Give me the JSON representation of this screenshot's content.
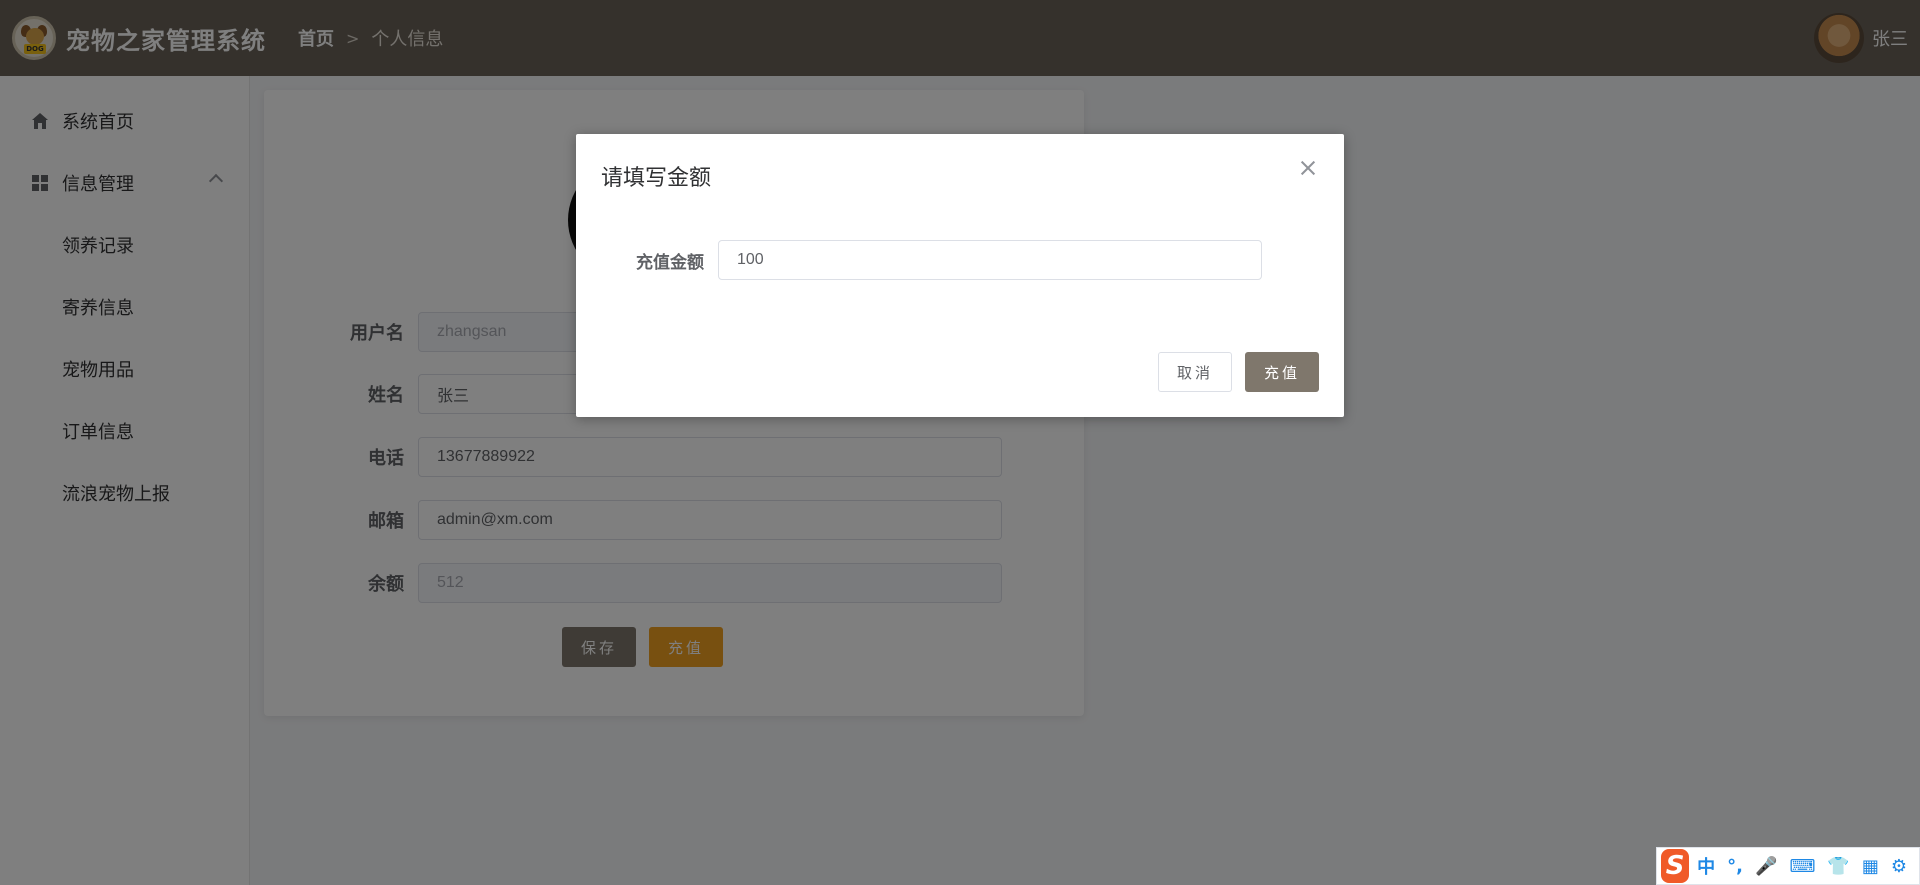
{
  "app": {
    "title": "宠物之家管理系统",
    "logo_tag": "DOG"
  },
  "header": {
    "breadcrumb_home": "首页",
    "breadcrumb_separator": ">",
    "breadcrumb_current": "个人信息",
    "user_name": "张三"
  },
  "sidebar": {
    "items": [
      {
        "label": "系统首页",
        "icon": "home-icon"
      },
      {
        "label": "信息管理",
        "icon": "grid-icon",
        "expanded": true
      }
    ],
    "sub_items": [
      {
        "label": "领养记录"
      },
      {
        "label": "寄养信息"
      },
      {
        "label": "宠物用品"
      },
      {
        "label": "订单信息"
      },
      {
        "label": "流浪宠物上报"
      }
    ]
  },
  "profile_form": {
    "username_label": "用户名",
    "username_value": "zhangsan",
    "name_label": "姓名",
    "name_value": "张三",
    "phone_label": "电话",
    "phone_value": "13677889922",
    "email_label": "邮箱",
    "email_value": "admin@xm.com",
    "balance_label": "余额",
    "balance_value": "512",
    "save_label": "保存",
    "recharge_label": "充值"
  },
  "dialog": {
    "title": "请填写金额",
    "amount_label": "充值金额",
    "amount_value": "100",
    "cancel_label": "取消",
    "confirm_label": "充值"
  },
  "ime": {
    "logo": "S",
    "items": [
      "中",
      "°,",
      "🎤",
      "⌨",
      "👕",
      "▦",
      "⚙"
    ]
  },
  "colors": {
    "header_bg": "#6b6359",
    "save_button": "#7f776c",
    "recharge_button": "#f0a020",
    "dialog_confirm": "#7f776c",
    "ime_accent": "#f05a28"
  }
}
